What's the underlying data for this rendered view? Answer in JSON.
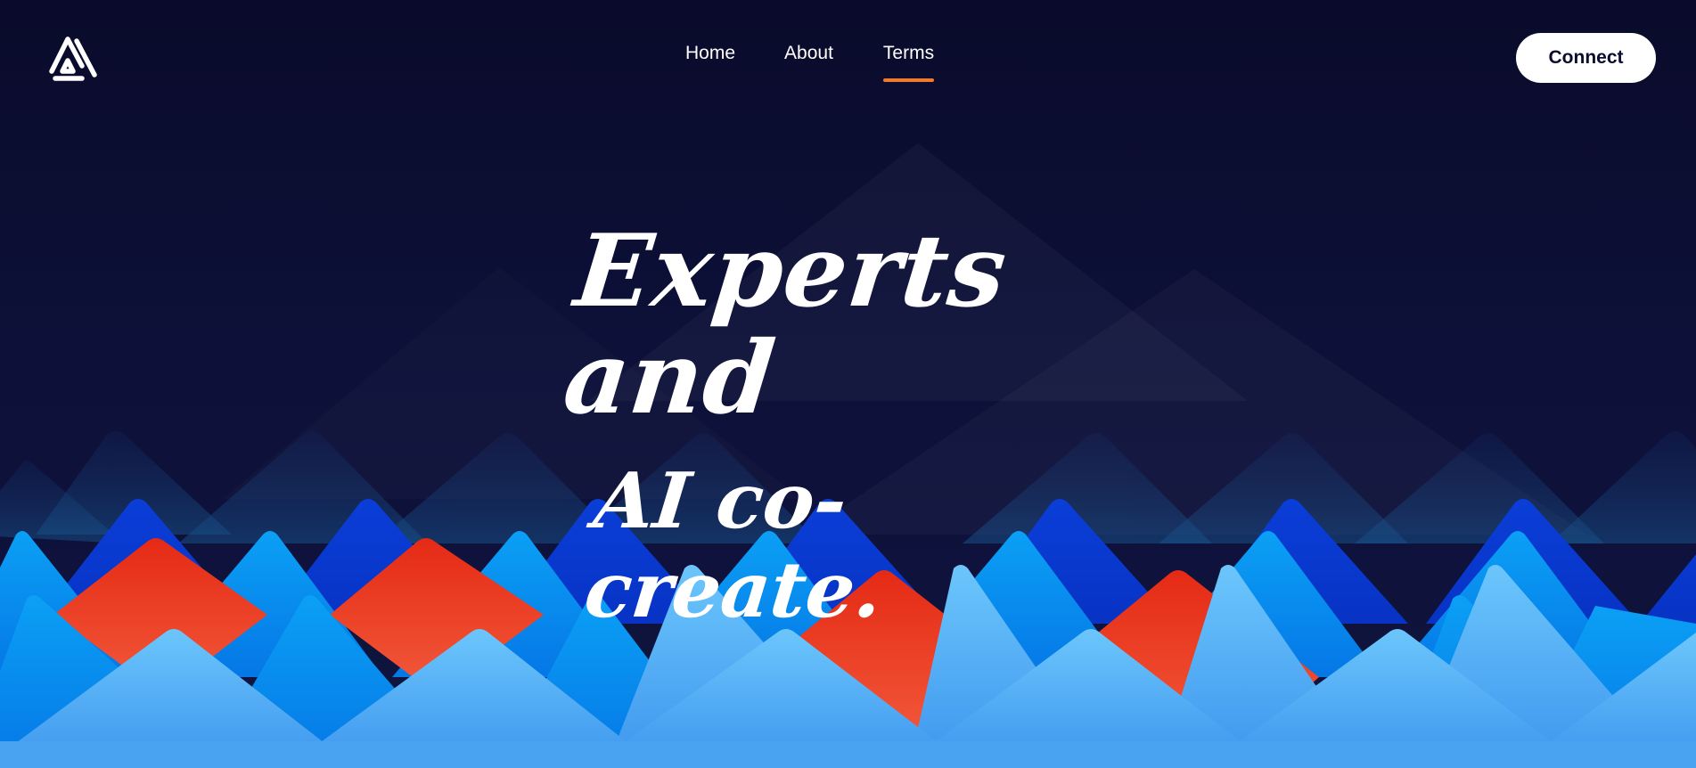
{
  "header": {
    "logo_icon": "triangle-logo-icon",
    "nav": {
      "items": [
        {
          "label": "Home",
          "active": false
        },
        {
          "label": "About",
          "active": false
        },
        {
          "label": "Terms",
          "active": true
        }
      ]
    },
    "connect_label": "Connect"
  },
  "hero": {
    "title_line1": "Experts and",
    "title_line2": "AI co-create."
  },
  "colors": {
    "background": "#0b0c2e",
    "active_underline": "#f07a2e",
    "button_bg": "#ffffff",
    "mountain_dark_blue": "#0a3ad8",
    "mountain_blue": "#0a8ef0",
    "mountain_light_blue": "#5ab8f8",
    "mountain_red": "#e83a1e"
  }
}
